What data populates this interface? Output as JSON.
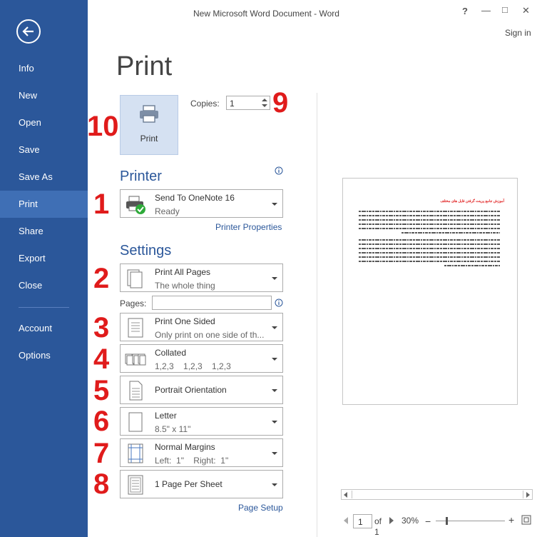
{
  "window": {
    "title": "New Microsoft Word Document - Word",
    "help": "?",
    "minimize": "—",
    "maximize": "□",
    "close": "✕",
    "sign_in": "Sign in"
  },
  "sidebar": {
    "items": [
      {
        "label": "Info"
      },
      {
        "label": "New"
      },
      {
        "label": "Open"
      },
      {
        "label": "Save"
      },
      {
        "label": "Save As"
      },
      {
        "label": "Print"
      },
      {
        "label": "Share"
      },
      {
        "label": "Export"
      },
      {
        "label": "Close"
      },
      {
        "label": "Account"
      },
      {
        "label": "Options"
      }
    ]
  },
  "print": {
    "title": "Print",
    "button_label": "Print",
    "copies_label": "Copies:",
    "copies_value": "1",
    "printer_heading": "Printer",
    "printer_name": "Send To OneNote 16",
    "printer_status": "Ready",
    "printer_properties": "Printer Properties",
    "settings_heading": "Settings",
    "pages_label": "Pages:",
    "page_setup": "Page Setup",
    "settings": [
      {
        "l1": "Print All Pages",
        "l2": "The whole thing"
      },
      {
        "l1": "Print One Sided",
        "l2": "Only print on one side of th..."
      },
      {
        "l1": "Collated",
        "l2": "1,2,3    1,2,3    1,2,3"
      },
      {
        "l1": "Portrait Orientation",
        "l2": ""
      },
      {
        "l1": "Letter",
        "l2": "8.5\" x 11\""
      },
      {
        "l1": "Normal Margins",
        "l2": "Left:  1\"    Right:  1\""
      },
      {
        "l1": "1 Page Per Sheet",
        "l2": ""
      }
    ]
  },
  "annotations": [
    "1",
    "2",
    "3",
    "4",
    "5",
    "6",
    "7",
    "8",
    "9",
    "10"
  ],
  "preview": {
    "heading": "آموزش جامع پرینت گرفتن فایل های مختلف",
    "page_value": "1",
    "of_label": "of",
    "total_pages": "1",
    "zoom": "30%",
    "zoom_fraction": 0.3
  },
  "colors": {
    "accent": "#2b579a",
    "sidebar_active": "#3f6fb5",
    "annotation": "#e01b1b"
  }
}
